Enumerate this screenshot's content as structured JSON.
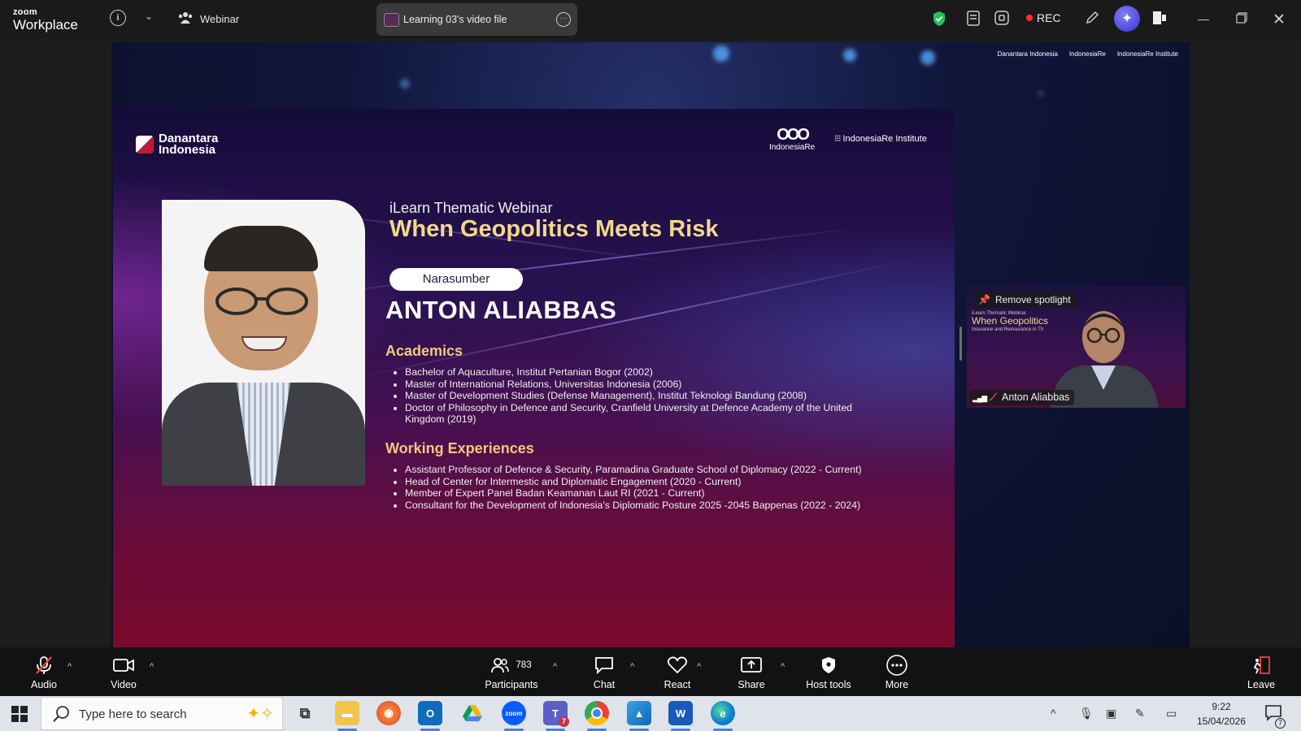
{
  "titlebar": {
    "logo_top": "zoom",
    "logo_bottom": "Workplace",
    "webinar_label": "Webinar",
    "meeting_title": "Learning 03's video file",
    "rec_label": "REC",
    "colors": {
      "rec_dot": "#ff2d2d",
      "shield": "#20c35a",
      "ai": "#5046e5"
    }
  },
  "stage": {
    "top_logos": [
      "Danantara Indonesia",
      "IndonesiaRe",
      "IndonesiaRe Institute"
    ]
  },
  "slide": {
    "logo_left": "Danantara Indonesia",
    "logo_ir": "IndonesiaRe",
    "logo_iri": "IndonesiaRe Institute",
    "subtitle": "iLearn Thematic Webinar",
    "title": "When Geopolitics Meets Risk",
    "speaker_label": "Narasumber",
    "speaker_name": "ANTON ALIABBAS",
    "academics_heading": "Academics",
    "academics": [
      "Bachelor of Aquaculture, Institut Pertanian Bogor (2002)",
      "Master of International Relations, Universitas Indonesia (2006)",
      "Master of Development Studies (Defense Management), Institut Teknologi Bandung (2008)",
      "Doctor of Philosophy in Defence and Security, Cranfield University at Defence Academy of the United Kingdom (2019)"
    ],
    "work_heading": "Working Experiences",
    "work": [
      "Assistant Professor of Defence & Security, Paramadina Graduate School of Diplomacy (2022 - Current)",
      "Head of Center for Intermestic and Diplomatic Engagement (2020 - Current)",
      "Member of Expert Panel Badan Keamanan Laut RI (2021 - Current)",
      "Consultant for the Development of Indonesia's Diplomatic Posture 2025 -2045 Bappenas (2022 - 2024)"
    ]
  },
  "spotlight": {
    "remove_label": "Remove spotlight",
    "name": "Anton Aliabbas",
    "bg_title": "When Geopolitics",
    "bg_sub1": "iLearn Thematic Webinar",
    "bg_sub2": "Insurance and Reinsurance in Th"
  },
  "controls": {
    "audio": "Audio",
    "video": "Video",
    "participants": "Participants",
    "participants_count": "783",
    "chat": "Chat",
    "react": "React",
    "share": "Share",
    "host_tools": "Host tools",
    "more": "More",
    "leave": "Leave"
  },
  "taskbar": {
    "search_placeholder": "Type here to search",
    "time": "9:22",
    "date": "15/04/2026",
    "notification_count": "7",
    "teams_badge": "7",
    "zoom_label": "zoom"
  }
}
